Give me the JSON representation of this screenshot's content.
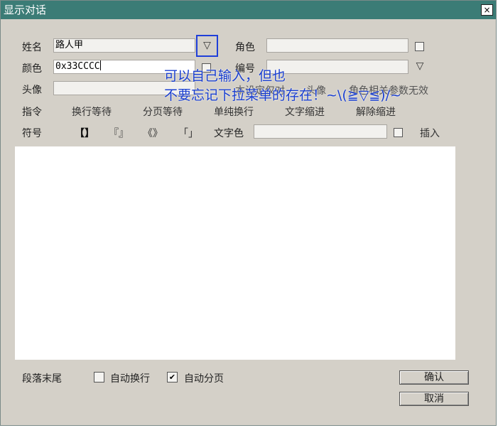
{
  "window": {
    "title": "显示对话",
    "close_glyph": "×"
  },
  "form": {
    "name_label": "姓名",
    "name_value": "路人甲",
    "role_label": "角色",
    "role_value": "",
    "color_label": "颜色",
    "color_value": "0x33CCCC",
    "number_label": "编号",
    "number_value": "",
    "avatar_label": "头像",
    "avatar_value": "",
    "hidden_hint_left": "本设定仅对",
    "hidden_hint_mid": "头像",
    "hidden_hint_right": "角色相关参数无效"
  },
  "commands": {
    "label": "指令",
    "items": [
      "换行等待",
      "分页等待",
      "单纯换行",
      "文字缩进",
      "解除缩进"
    ]
  },
  "symbols": {
    "label": "符号",
    "items": [
      "【】",
      "『』",
      "《》",
      "「」"
    ],
    "text_color_label": "文字色",
    "text_color_value": "",
    "insert_label": "插入"
  },
  "body_text": "",
  "paragraph_end": {
    "label": "段落末尾",
    "auto_newline_label": "自动换行",
    "auto_newline_checked": false,
    "auto_page_label": "自动分页",
    "auto_page_checked": true,
    "check_glyph": "✔"
  },
  "buttons": {
    "ok": "确认",
    "cancel": "取消"
  },
  "annotation": {
    "line1": "可以自己输入，但也",
    "line2": "不要忘记下拉菜单的存在！~\\(≧▽≦)/~"
  },
  "dropdown_glyph": "▽",
  "colors": {
    "titlebar": "#3b7c76",
    "dialog_bg": "#d4d0c8",
    "annotation": "#1a3fd0",
    "highlight_border": "#1f3fd9"
  }
}
